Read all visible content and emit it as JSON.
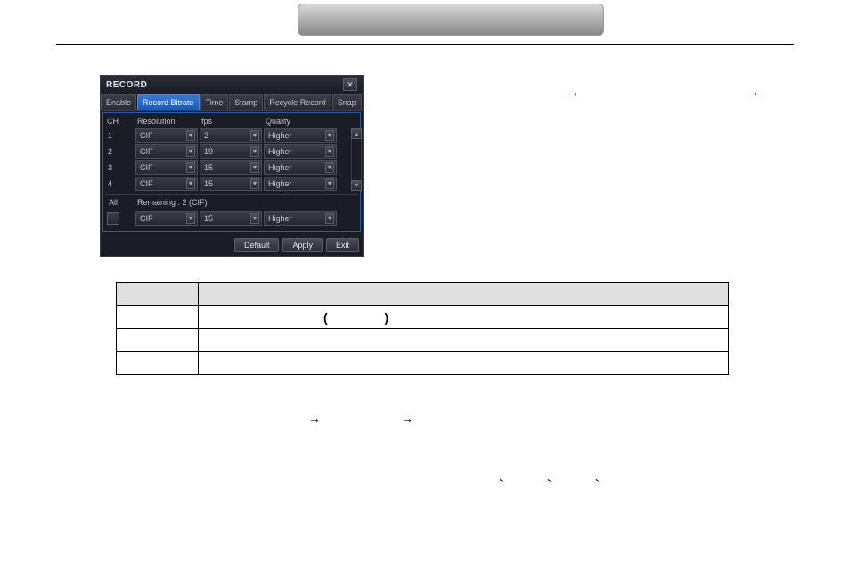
{
  "dialog": {
    "title": "RECORD",
    "tabs": {
      "enable": "Enable",
      "bitrate": "Record Bitrate",
      "time": "Time",
      "stamp": "Stamp",
      "recycle": "Recycle Record",
      "snap": "Snap"
    },
    "headers": {
      "ch": "CH",
      "resolution": "Resolution",
      "fps": "fps",
      "quality": "Quality"
    },
    "rows": [
      {
        "ch": "1",
        "resolution": "CIF",
        "fps": "2",
        "quality": "Higher"
      },
      {
        "ch": "2",
        "resolution": "CIF",
        "fps": "19",
        "quality": "Higher"
      },
      {
        "ch": "3",
        "resolution": "CIF",
        "fps": "15",
        "quality": "Higher"
      },
      {
        "ch": "4",
        "resolution": "CIF",
        "fps": "15",
        "quality": "Higher"
      }
    ],
    "all_label": "All",
    "remaining": "Remaining : 2 (CIF)",
    "all_row": {
      "resolution": "CIF",
      "fps": "15",
      "quality": "Higher"
    },
    "buttons": {
      "default": "Default",
      "apply": "Apply",
      "exit": "Exit"
    }
  },
  "symbols": {
    "arrow": "→",
    "ticks": "、 、 、",
    "parens": "( )"
  }
}
